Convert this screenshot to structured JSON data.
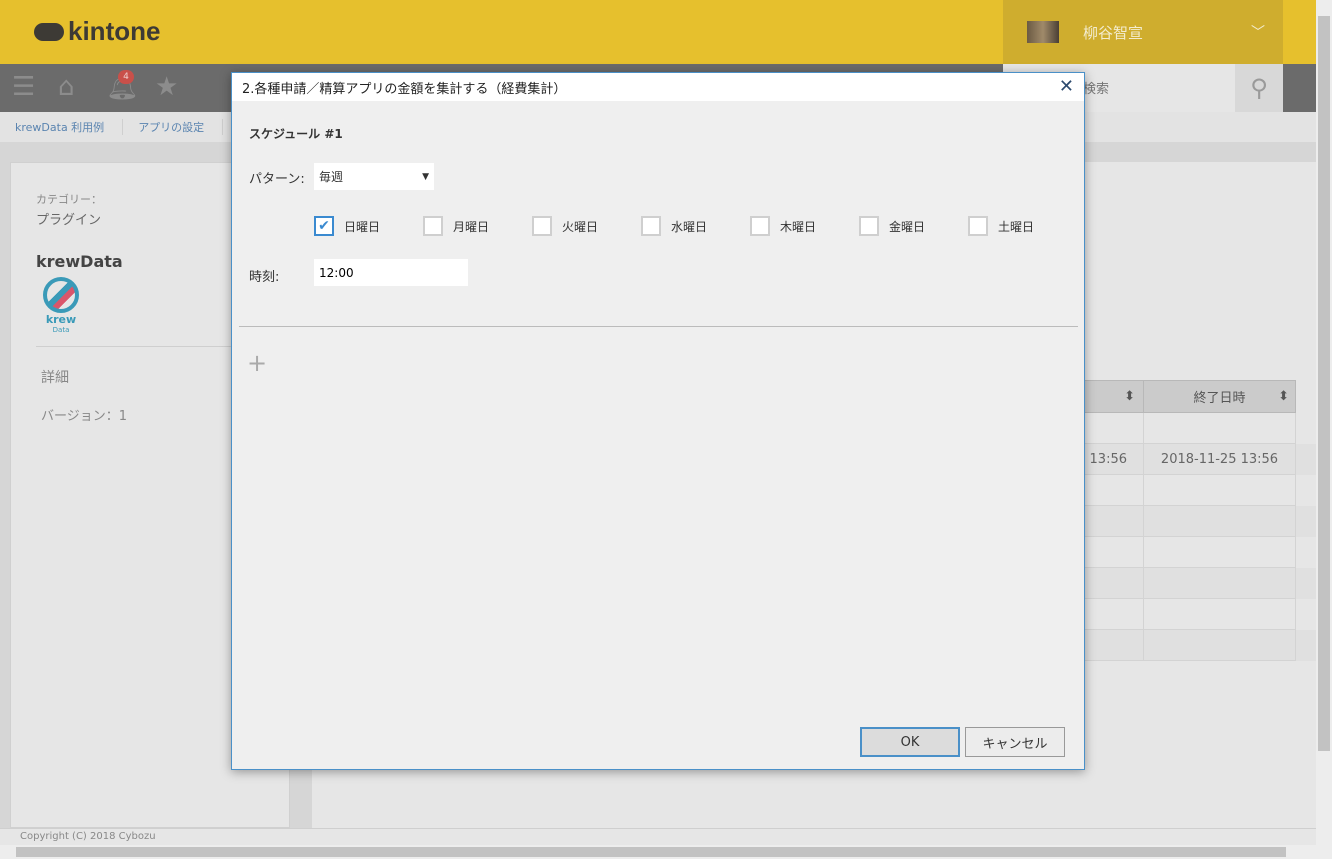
{
  "header": {
    "logo": "kintone",
    "user_name": "柳谷智宣",
    "notification_count": "4",
    "search_placeholder": "検索"
  },
  "breadcrumb": [
    "krewData 利用例",
    "アプリの設定"
  ],
  "left_panel": {
    "category_label": "カテゴリー：",
    "category_value": "プラグイン",
    "plugin_name": "krewData",
    "logo_text": "krew",
    "logo_sub": "Data",
    "details_label": "詳細",
    "version": "バージョン：1"
  },
  "table": {
    "headers": [
      "",
      "終了日時"
    ],
    "rows": [
      [
        "",
        ""
      ],
      [
        "13:56",
        "2018-11-25 13:56"
      ],
      [
        "",
        ""
      ],
      [
        "",
        ""
      ],
      [
        "",
        ""
      ],
      [
        "",
        ""
      ],
      [
        "",
        ""
      ],
      [
        "",
        ""
      ]
    ]
  },
  "footer": "Copyright (C) 2018 Cybozu",
  "dialog": {
    "title": "2.各種申請／精算アプリの金額を集計する（経費集計）",
    "schedule_title": "スケジュール #1",
    "pattern_label": "パターン:",
    "pattern_value": "毎週",
    "days": [
      {
        "label": "日曜日",
        "checked": true
      },
      {
        "label": "月曜日",
        "checked": false
      },
      {
        "label": "火曜日",
        "checked": false
      },
      {
        "label": "水曜日",
        "checked": false
      },
      {
        "label": "木曜日",
        "checked": false
      },
      {
        "label": "金曜日",
        "checked": false
      },
      {
        "label": "土曜日",
        "checked": false
      }
    ],
    "time_label": "時刻:",
    "time_value": "12:00",
    "add_icon": "+",
    "ok_label": "OK",
    "cancel_label": "キャンセル"
  }
}
